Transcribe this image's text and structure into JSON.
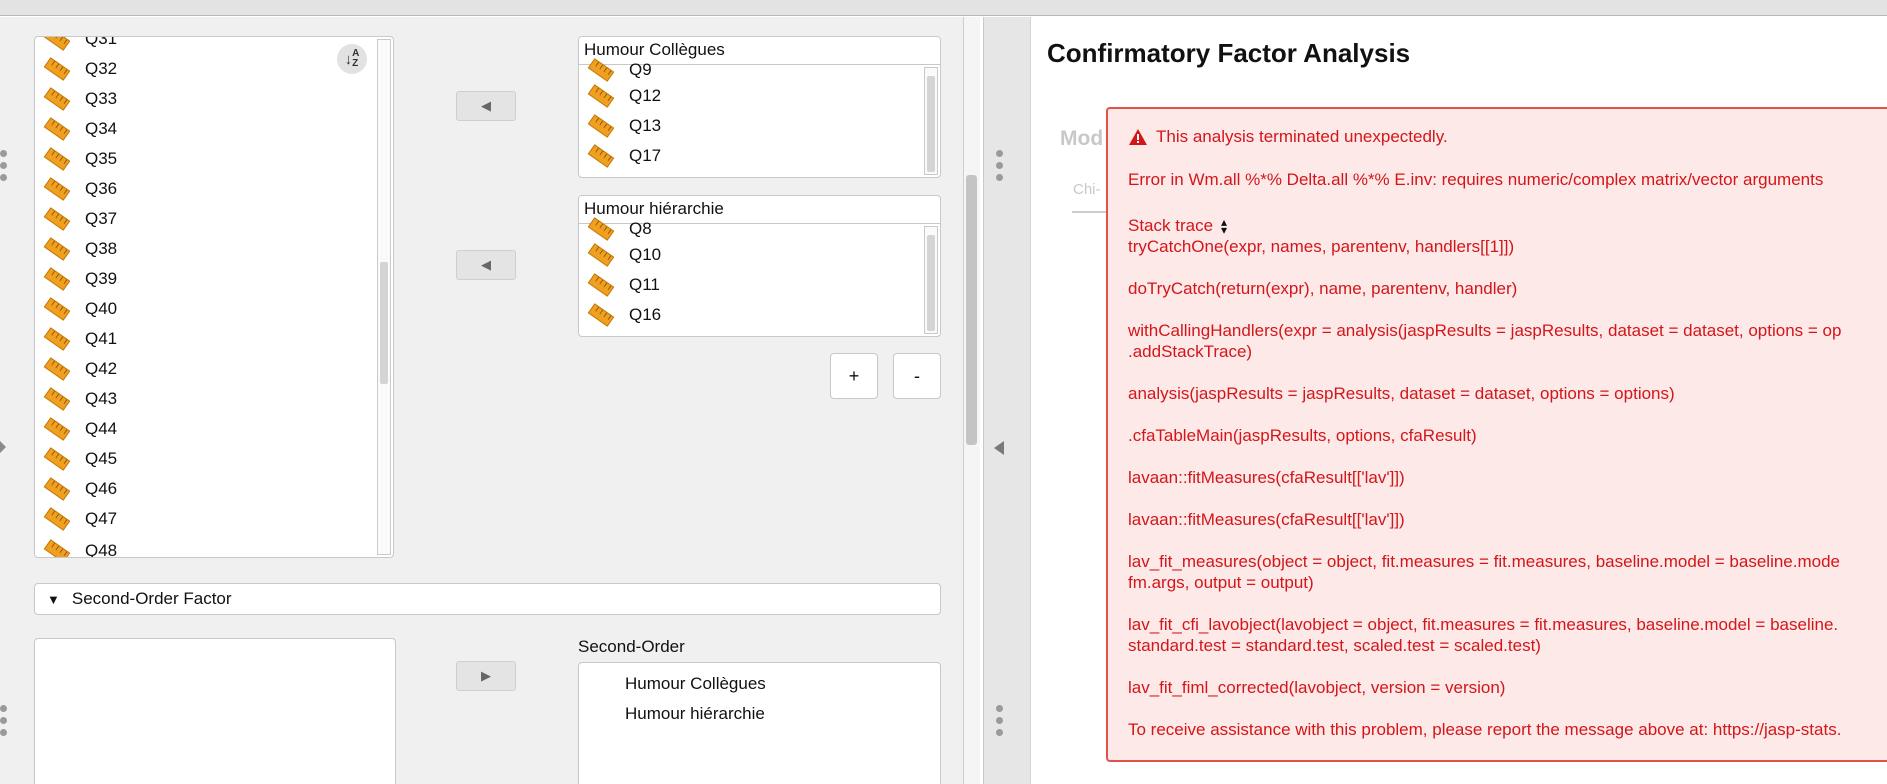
{
  "variables": {
    "partial_top": "Q31",
    "items": [
      "Q32",
      "Q33",
      "Q34",
      "Q35",
      "Q36",
      "Q37",
      "Q38",
      "Q39",
      "Q40",
      "Q41",
      "Q42",
      "Q43",
      "Q44",
      "Q45",
      "Q46",
      "Q47"
    ],
    "partial_bottom": "Q48"
  },
  "factors": [
    {
      "name": "Humour Collègues",
      "partial": "Q9",
      "items": [
        "Q12",
        "Q13",
        "Q17"
      ]
    },
    {
      "name": "Humour hiérarchie",
      "partial": "Q8",
      "items": [
        "Q10",
        "Q11",
        "Q16"
      ]
    }
  ],
  "factor_buttons": {
    "add": "+",
    "remove": "-"
  },
  "second_order": {
    "section_label": "Second-Order Factor",
    "list_title": "Second-Order",
    "items": [
      "Humour Collègues",
      "Humour hiérarchie"
    ]
  },
  "output": {
    "title": "Confirmatory Factor Analysis",
    "ghost_heading": "Mod",
    "ghost_row": "Chi-",
    "error": {
      "headline": "This analysis terminated unexpectedly.",
      "message": "Error in Wm.all %*% Delta.all %*% E.inv: requires numeric/complex matrix/vector arguments",
      "stack_label": "Stack trace",
      "lines": [
        "tryCatchOne(expr, names, parentenv, handlers[[1]])",
        "doTryCatch(return(expr), name, parentenv, handler)",
        "withCallingHandlers(expr = analysis(jaspResults = jaspResults, dataset = dataset, options = op",
        ".addStackTrace)",
        "analysis(jaspResults = jaspResults, dataset = dataset, options = options)",
        ".cfaTableMain(jaspResults, options, cfaResult)",
        "lavaan::fitMeasures(cfaResult[['lav']])",
        "lavaan::fitMeasures(cfaResult[['lav']])",
        "lav_fit_measures(object = object, fit.measures = fit.measures, baseline.model = baseline.mode",
        "fm.args, output = output)",
        "lav_fit_cfi_lavobject(lavobject = object, fit.measures = fit.measures, baseline.model = baseline.",
        "standard.test = standard.test, scaled.test = scaled.test)",
        "lav_fit_fiml_corrected(lavobject, version = version)",
        "To receive assistance with this problem, please report the message above at: https://jasp-stats."
      ]
    }
  },
  "colors": {
    "error_text": "#d3161a",
    "error_bg": "#fde9e8",
    "error_border": "#e0524a",
    "ruler": "#f0a020"
  }
}
